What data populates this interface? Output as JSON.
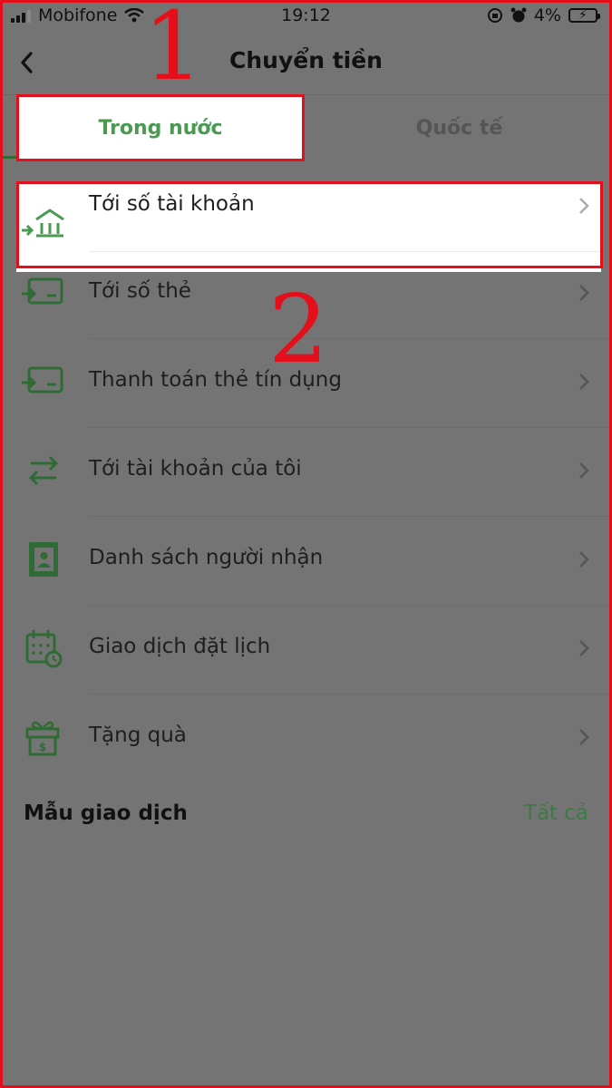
{
  "status_bar": {
    "carrier": "Mobifone",
    "time": "19:12",
    "battery": "4%"
  },
  "header": {
    "title": "Chuyển tiền"
  },
  "tabs": [
    {
      "label": "Trong nước",
      "active": true
    },
    {
      "label": "Quốc tế",
      "active": false
    }
  ],
  "menu": [
    {
      "label": "Tới số tài khoản",
      "icon": "bank-transfer-icon"
    },
    {
      "label": "Tới số thẻ",
      "icon": "card-transfer-icon"
    },
    {
      "label": "Thanh toán thẻ tín dụng",
      "icon": "credit-card-payment-icon"
    },
    {
      "label": "Tới tài khoản của tôi",
      "icon": "swap-arrows-icon"
    },
    {
      "label": "Danh sách người nhận",
      "icon": "contact-book-icon"
    },
    {
      "label": "Giao dịch đặt lịch",
      "icon": "calendar-clock-icon"
    },
    {
      "label": "Tặng quà",
      "icon": "gift-icon"
    }
  ],
  "templates": {
    "title": "Mẫu giao dịch",
    "view_all": "Tất cả"
  },
  "annotations": [
    "1",
    "2"
  ],
  "colors": {
    "accent": "#4a9a52",
    "icon": "#2f6b35",
    "highlight": "#e30f1a",
    "overlay": "#747474"
  }
}
